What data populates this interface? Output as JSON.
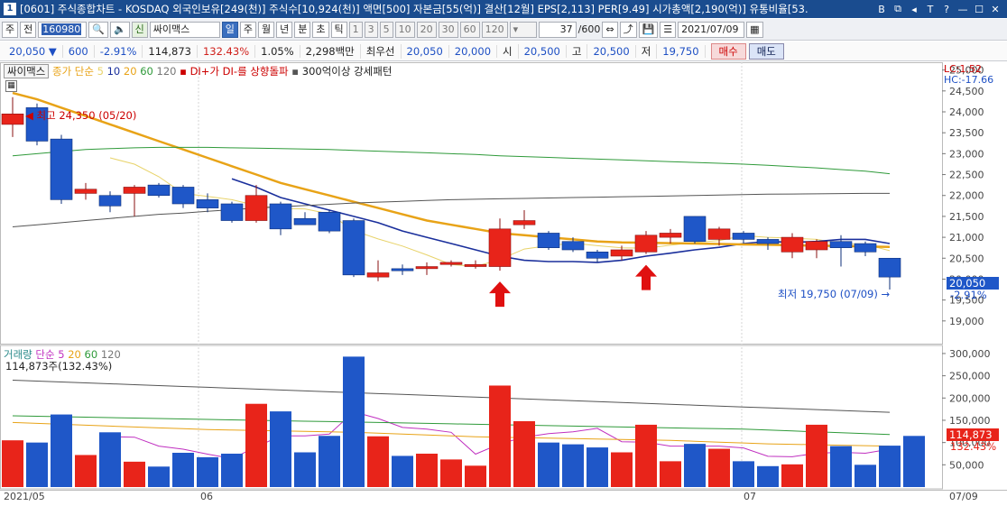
{
  "window": {
    "number": "1",
    "title": "[0601] 주식종합차트 - KOSDAQ 외국인보유[249(천)] 주식수[10,924(천)] 액면[500] 자본금[55(억)] 결산[12월] EPS[2,113] PER[9.49] 시가총액[2,190(억)] 유통비율[53.",
    "buttons": [
      "B",
      "⧉",
      "◂",
      "T",
      "?",
      "—",
      "☐",
      "✕"
    ]
  },
  "toolbar": {
    "market": "주",
    "market_mode": "전",
    "code": "160980",
    "search_icon": "search-icon",
    "sound_icon": "speaker-icon",
    "new_label": "신",
    "stock_name": "싸이맥스",
    "periods": [
      "일",
      "주",
      "월",
      "년",
      "분",
      "초",
      "틱"
    ],
    "period_selected": "일",
    "numbers": [
      "1",
      "3",
      "5",
      "10",
      "20",
      "30",
      "60",
      "120"
    ],
    "count": "37",
    "count_total": "/600",
    "date": "2021/07/09"
  },
  "quote": {
    "price": "20,050",
    "change": "600",
    "change_pct": "-2.91%",
    "volume": "114,873",
    "volume_ratio": "132.43%",
    "turnover": "1.05%",
    "amount": "2,298백만",
    "best_ask_label": "최우선",
    "best_ask": "20,050",
    "best_bid": "20,000",
    "open_label": "시",
    "open": "20,500",
    "high_label": "고",
    "high": "20,500",
    "low_label": "저",
    "low": "19,750",
    "buy_label": "매수",
    "sell_label": "매도"
  },
  "price_legend": {
    "name": "싸이맥스",
    "ma_label": "종가 단순",
    "ma_periods": [
      "5",
      "10",
      "20",
      "60",
      "120"
    ],
    "di_label": "DI+가 DI-를 상향돌파",
    "pattern_label": "300억이상 강세패턴",
    "lc": "LC:1.52",
    "hc": "HC:-17.66"
  },
  "volume_legend": {
    "label": "거래량",
    "ma_label": "단순",
    "ma_periods": [
      "5",
      "20",
      "60",
      "120"
    ],
    "current": "114,873주(132.43%)"
  },
  "annotations": {
    "high": "최고 24,350 (05/20)",
    "low": "최저 19,750 (07/09)",
    "last_price": "20,050",
    "last_pct": "-2.91%",
    "last_volume": "114,873",
    "last_volume_pct": "132.43%"
  },
  "colors": {
    "up": "#e8241a",
    "down": "#1f57c8",
    "ma5": "#e8d36a",
    "ma10": "#1a2f9c",
    "ma20": "#e8a317",
    "ma60": "#2f9a3a",
    "ma120": "#555555",
    "signal_arrow": "#e01010"
  },
  "chart_data": {
    "type": "candlestick",
    "x_labels": [
      "2021/05",
      "06",
      "07",
      "07/09"
    ],
    "price_axis": [
      "25,000",
      "24,500",
      "24,000",
      "23,500",
      "23,000",
      "22,500",
      "22,000",
      "21,500",
      "21,000",
      "20,500",
      "20,000",
      "19,500",
      "19,000"
    ],
    "ylim": [
      18500,
      25100
    ],
    "volume_axis": [
      "300,000",
      "250,000",
      "200,000",
      "150,000",
      "100,000",
      "50,000"
    ],
    "volume_ylim": [
      0,
      310000
    ],
    "candles": [
      {
        "o": 23700,
        "h": 24350,
        "l": 23400,
        "c": 23950
      },
      {
        "o": 24100,
        "h": 24200,
        "l": 23200,
        "c": 23300
      },
      {
        "o": 23350,
        "h": 23450,
        "l": 21800,
        "c": 21900
      },
      {
        "o": 22050,
        "h": 22300,
        "l": 21900,
        "c": 22150
      },
      {
        "o": 22000,
        "h": 22100,
        "l": 21600,
        "c": 21750
      },
      {
        "o": 22050,
        "h": 22250,
        "l": 21500,
        "c": 22200
      },
      {
        "o": 22250,
        "h": 22300,
        "l": 21950,
        "c": 22000
      },
      {
        "o": 22200,
        "h": 22250,
        "l": 21700,
        "c": 21800
      },
      {
        "o": 21900,
        "h": 22050,
        "l": 21600,
        "c": 21700
      },
      {
        "o": 21800,
        "h": 21850,
        "l": 21350,
        "c": 21400
      },
      {
        "o": 21400,
        "h": 22250,
        "l": 21350,
        "c": 22000
      },
      {
        "o": 21800,
        "h": 21850,
        "l": 21050,
        "c": 21200
      },
      {
        "o": 21450,
        "h": 21600,
        "l": 21300,
        "c": 21300
      },
      {
        "o": 21600,
        "h": 21650,
        "l": 21100,
        "c": 21150
      },
      {
        "o": 21400,
        "h": 21450,
        "l": 20050,
        "c": 20100
      },
      {
        "o": 20050,
        "h": 20450,
        "l": 19950,
        "c": 20150
      },
      {
        "o": 20250,
        "h": 20350,
        "l": 20100,
        "c": 20200
      },
      {
        "o": 20250,
        "h": 20400,
        "l": 20100,
        "c": 20300
      },
      {
        "o": 20350,
        "h": 20450,
        "l": 20300,
        "c": 20400
      },
      {
        "o": 20300,
        "h": 20450,
        "l": 20250,
        "c": 20350
      },
      {
        "o": 20300,
        "h": 21450,
        "l": 20200,
        "c": 21200
      },
      {
        "o": 21300,
        "h": 21650,
        "l": 21200,
        "c": 21400
      },
      {
        "o": 21100,
        "h": 21150,
        "l": 20700,
        "c": 20750
      },
      {
        "o": 20900,
        "h": 21000,
        "l": 20650,
        "c": 20700
      },
      {
        "o": 20650,
        "h": 20700,
        "l": 20400,
        "c": 20500
      },
      {
        "o": 20550,
        "h": 20800,
        "l": 20450,
        "c": 20700
      },
      {
        "o": 20650,
        "h": 21150,
        "l": 20600,
        "c": 21050
      },
      {
        "o": 21000,
        "h": 21200,
        "l": 20850,
        "c": 21100
      },
      {
        "o": 21500,
        "h": 21500,
        "l": 20850,
        "c": 20900
      },
      {
        "o": 20950,
        "h": 21250,
        "l": 20800,
        "c": 21200
      },
      {
        "o": 21100,
        "h": 21150,
        "l": 20850,
        "c": 20950
      },
      {
        "o": 20950,
        "h": 21000,
        "l": 20700,
        "c": 20850
      },
      {
        "o": 20650,
        "h": 21100,
        "l": 20500,
        "c": 21000
      },
      {
        "o": 20700,
        "h": 20950,
        "l": 20500,
        "c": 20900
      },
      {
        "o": 20900,
        "h": 21050,
        "l": 20300,
        "c": 20750
      },
      {
        "o": 20850,
        "h": 20900,
        "l": 20550,
        "c": 20650
      },
      {
        "o": 20500,
        "h": 20500,
        "l": 19750,
        "c": 20050
      }
    ],
    "volumes": [
      105000,
      100000,
      163000,
      72000,
      123000,
      57000,
      46000,
      77000,
      67000,
      75000,
      187000,
      170000,
      78000,
      115000,
      293000,
      114000,
      70000,
      75000,
      62000,
      48000,
      228000,
      148000,
      100000,
      96000,
      89000,
      78000,
      140000,
      58000,
      97000,
      86000,
      58000,
      47000,
      51000,
      140000,
      92000,
      50000,
      93000,
      114873
    ],
    "series": [
      {
        "name": "5",
        "values": [
          null,
          null,
          null,
          null,
          22900,
          22750,
          22450,
          22050,
          21980,
          21900,
          21760,
          21690,
          21680,
          21560,
          21160,
          20960,
          20790,
          20580,
          20350,
          20300,
          20470,
          20720,
          20800,
          20860,
          20800,
          20750,
          20740,
          20810,
          20880,
          20920,
          21040,
          21000,
          20980,
          20950,
          20850,
          20830,
          20680
        ]
      },
      {
        "name": "10",
        "values": [
          null,
          null,
          null,
          null,
          null,
          null,
          null,
          null,
          null,
          22400,
          22200,
          21950,
          21800,
          21650,
          21500,
          21350,
          21150,
          21000,
          20850,
          20700,
          20550,
          20450,
          20420,
          20420,
          20400,
          20450,
          20550,
          20620,
          20700,
          20760,
          20850,
          20900,
          20880,
          20900,
          20950,
          20950,
          20850
        ]
      },
      {
        "name": "20",
        "values": [
          24450,
          24300,
          24100,
          23900,
          23700,
          23500,
          23300,
          23100,
          22900,
          22700,
          22500,
          22300,
          22150,
          22000,
          21850,
          21700,
          21550,
          21400,
          21300,
          21200,
          21100,
          21050,
          21000,
          20950,
          20900,
          20880,
          20870,
          20860,
          20850,
          20840,
          20830,
          20820,
          20810,
          20800,
          20790,
          20780,
          20770
        ]
      },
      {
        "name": "60",
        "values": [
          22950,
          23000,
          23050,
          23100,
          23120,
          23140,
          23150,
          23150,
          23150,
          23140,
          23130,
          23120,
          23110,
          23100,
          23080,
          23060,
          23040,
          23020,
          23000,
          22980,
          22950,
          22930,
          22910,
          22890,
          22870,
          22850,
          22830,
          22810,
          22790,
          22770,
          22750,
          22720,
          22690,
          22660,
          22620,
          22580,
          22520
        ]
      },
      {
        "name": "120",
        "values": [
          21250,
          21300,
          21350,
          21400,
          21450,
          21500,
          21550,
          21580,
          21620,
          21660,
          21700,
          21730,
          21760,
          21790,
          21820,
          21840,
          21860,
          21880,
          21900,
          21910,
          21920,
          21930,
          21940,
          21950,
          21960,
          21970,
          21980,
          21990,
          22000,
          22010,
          22020,
          22030,
          22035,
          22040,
          22045,
          22050,
          22050
        ]
      }
    ],
    "volume_ma": [
      {
        "name": "5",
        "values": [
          null,
          null,
          null,
          null,
          113000,
          112000,
          92000,
          85000,
          74000,
          64000,
          90000,
          115000,
          115000,
          119000,
          169000,
          154000,
          134000,
          130000,
          123000,
          74000,
          97000,
          112000,
          120000,
          124000,
          132000,
          102000,
          101000,
          92000,
          92000,
          92000,
          88000,
          69000,
          68000,
          76000,
          78000,
          76000,
          85000
        ]
      },
      {
        "name": "20",
        "values": [
          145000,
          143000,
          141000,
          139000,
          137000,
          135000,
          133000,
          131000,
          129000,
          128000,
          127000,
          126000,
          125000,
          124000,
          123000,
          121000,
          119000,
          117000,
          115000,
          113000,
          112000,
          111000,
          110000,
          109000,
          108000,
          107000,
          106000,
          105000,
          103000,
          101000,
          99000,
          97000,
          96000,
          95000,
          94000,
          93000,
          92000
        ]
      },
      {
        "name": "60",
        "values": [
          160000,
          159000,
          158000,
          157000,
          156000,
          155000,
          154000,
          153000,
          152000,
          151000,
          150000,
          149000,
          148000,
          147000,
          146000,
          145000,
          144000,
          143000,
          142000,
          141000,
          140000,
          139000,
          138000,
          137000,
          136000,
          135000,
          134000,
          133000,
          132000,
          131000,
          130000,
          128000,
          126000,
          124000,
          122000,
          120000,
          118000
        ]
      },
      {
        "name": "120",
        "values": [
          240000,
          238000,
          236000,
          234000,
          232000,
          230000,
          228000,
          226000,
          224000,
          222000,
          220000,
          218000,
          216000,
          214000,
          212000,
          210000,
          208000,
          206000,
          204000,
          202000,
          200000,
          198000,
          196000,
          194000,
          192000,
          190000,
          188000,
          186000,
          184000,
          182000,
          180000,
          178000,
          176000,
          174000,
          172000,
          170000,
          168000
        ]
      }
    ],
    "signal_arrows_at": [
      20,
      26
    ]
  }
}
